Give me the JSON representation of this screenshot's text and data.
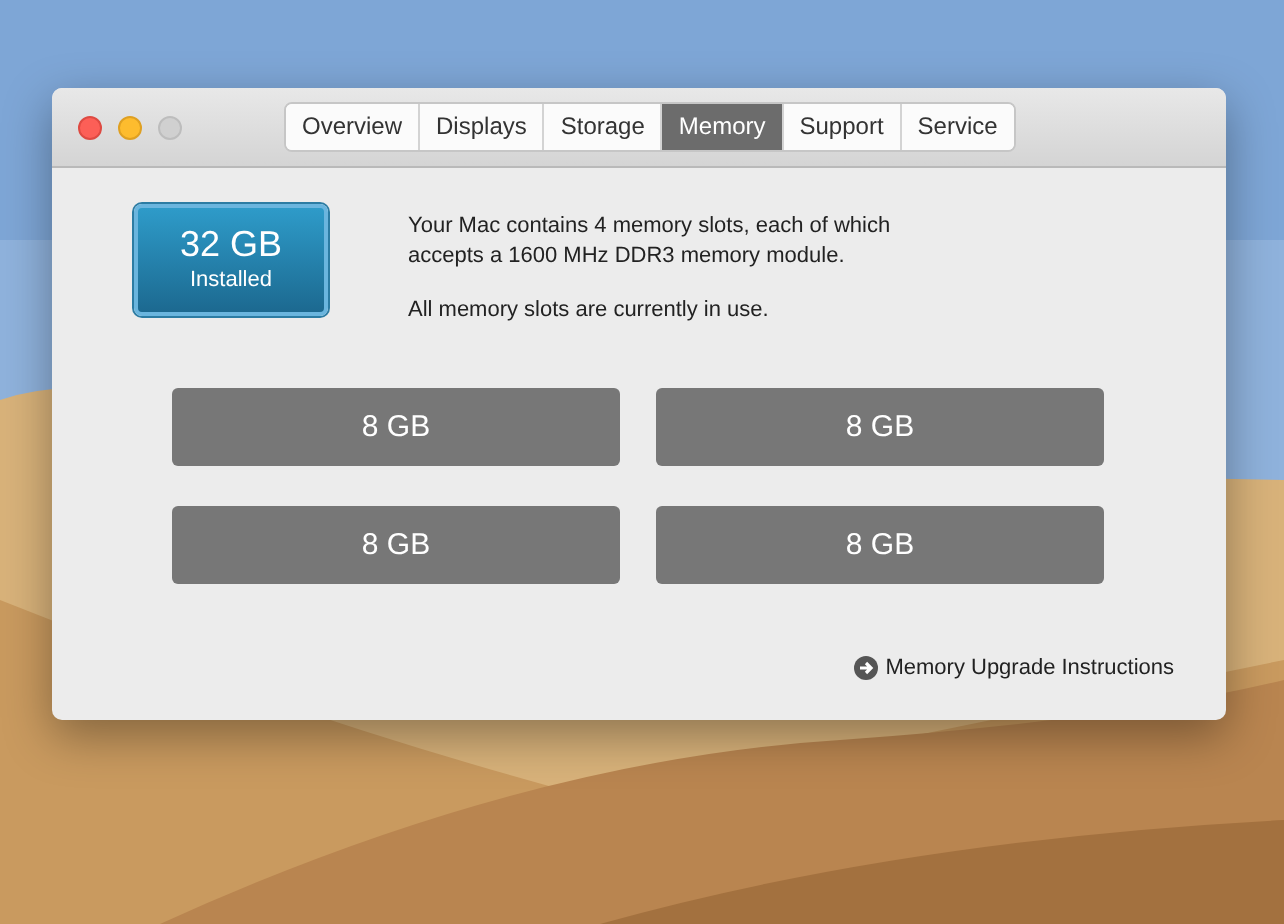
{
  "tabs": [
    {
      "label": "Overview",
      "selected": false
    },
    {
      "label": "Displays",
      "selected": false
    },
    {
      "label": "Storage",
      "selected": false
    },
    {
      "label": "Memory",
      "selected": true
    },
    {
      "label": "Support",
      "selected": false
    },
    {
      "label": "Service",
      "selected": false
    }
  ],
  "installed": {
    "amount": "32 GB",
    "label": "Installed"
  },
  "description": "Your Mac contains 4 memory slots, each of which accepts a 1600 MHz DDR3 memory module.",
  "status": "All memory slots are currently in use.",
  "slots": [
    "8 GB",
    "8 GB",
    "8 GB",
    "8 GB"
  ],
  "link": "Memory Upgrade Instructions"
}
